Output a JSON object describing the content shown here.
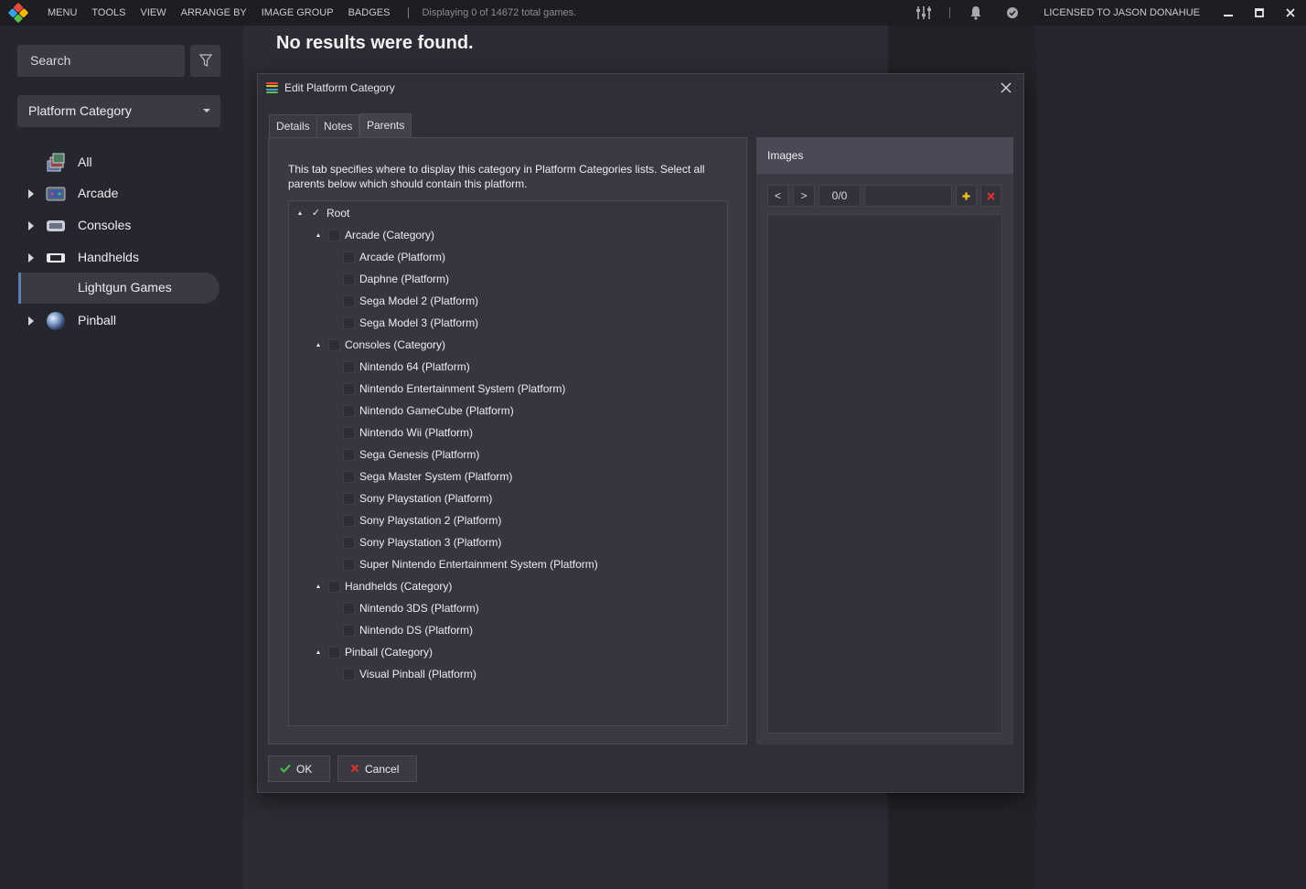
{
  "topbar": {
    "menu_items": [
      "MENU",
      "TOOLS",
      "VIEW",
      "ARRANGE BY",
      "IMAGE GROUP",
      "BADGES"
    ],
    "status": "Displaying 0 of 14672 total games.",
    "license": "LICENSED TO JASON DONAHUE",
    "window_controls": [
      "minimize",
      "maximize",
      "close"
    ]
  },
  "sidebar": {
    "search_placeholder": "Search",
    "view_dropdown": "Platform Category",
    "items": [
      {
        "label": "All",
        "icon": "collection-icon",
        "expandable": false
      },
      {
        "label": "Arcade",
        "icon": "arcade-icon",
        "expandable": true
      },
      {
        "label": "Consoles",
        "icon": "console-icon",
        "expandable": true
      },
      {
        "label": "Handhelds",
        "icon": "handheld-icon",
        "expandable": true
      },
      {
        "label": "Lightgun Games",
        "icon": "",
        "expandable": false,
        "selected": true
      },
      {
        "label": "Pinball",
        "icon": "pinball-icon",
        "expandable": true
      }
    ]
  },
  "main": {
    "message": "No results were found."
  },
  "dialog": {
    "title": "Edit Platform Category",
    "tabs": [
      "Details",
      "Notes",
      "Parents"
    ],
    "active_tab": "Parents",
    "description": "This tab specifies where to display this category in Platform Categories lists. Select all parents below which should contain this platform.",
    "tree": [
      {
        "label": "Root",
        "level": 0,
        "expandable": true,
        "checked": true
      },
      {
        "label": "Arcade (Category)",
        "level": 1,
        "expandable": true,
        "checked": false
      },
      {
        "label": "Arcade (Platform)",
        "level": 2,
        "expandable": false,
        "checked": false
      },
      {
        "label": "Daphne (Platform)",
        "level": 2,
        "expandable": false,
        "checked": false
      },
      {
        "label": "Sega Model 2 (Platform)",
        "level": 2,
        "expandable": false,
        "checked": false
      },
      {
        "label": "Sega Model 3 (Platform)",
        "level": 2,
        "expandable": false,
        "checked": false
      },
      {
        "label": "Consoles (Category)",
        "level": 1,
        "expandable": true,
        "checked": false
      },
      {
        "label": "Nintendo 64 (Platform)",
        "level": 2,
        "expandable": false,
        "checked": false
      },
      {
        "label": "Nintendo Entertainment System (Platform)",
        "level": 2,
        "expandable": false,
        "checked": false
      },
      {
        "label": "Nintendo GameCube (Platform)",
        "level": 2,
        "expandable": false,
        "checked": false
      },
      {
        "label": "Nintendo Wii (Platform)",
        "level": 2,
        "expandable": false,
        "checked": false
      },
      {
        "label": "Sega Genesis (Platform)",
        "level": 2,
        "expandable": false,
        "checked": false
      },
      {
        "label": "Sega Master System (Platform)",
        "level": 2,
        "expandable": false,
        "checked": false
      },
      {
        "label": "Sony Playstation (Platform)",
        "level": 2,
        "expandable": false,
        "checked": false
      },
      {
        "label": "Sony Playstation 2 (Platform)",
        "level": 2,
        "expandable": false,
        "checked": false
      },
      {
        "label": "Sony Playstation 3 (Platform)",
        "level": 2,
        "expandable": false,
        "checked": false
      },
      {
        "label": "Super Nintendo Entertainment System (Platform)",
        "level": 2,
        "expandable": false,
        "checked": false
      },
      {
        "label": "Handhelds (Category)",
        "level": 1,
        "expandable": true,
        "checked": false
      },
      {
        "label": "Nintendo 3DS (Platform)",
        "level": 2,
        "expandable": false,
        "checked": false
      },
      {
        "label": "Nintendo DS (Platform)",
        "level": 2,
        "expandable": false,
        "checked": false
      },
      {
        "label": "Pinball (Category)",
        "level": 1,
        "expandable": true,
        "checked": false
      },
      {
        "label": "Visual Pinball (Platform)",
        "level": 2,
        "expandable": false,
        "checked": false
      }
    ],
    "images": {
      "header": "Images",
      "prev_label": "<",
      "next_label": ">",
      "counter": "0/0",
      "type_value": ""
    },
    "ok_label": "OK",
    "cancel_label": "Cancel"
  },
  "colors": {
    "accent": "#5b7fb0",
    "ok_check": "#4cc14c",
    "cancel_x": "#e03030",
    "add": "#f0c020"
  }
}
